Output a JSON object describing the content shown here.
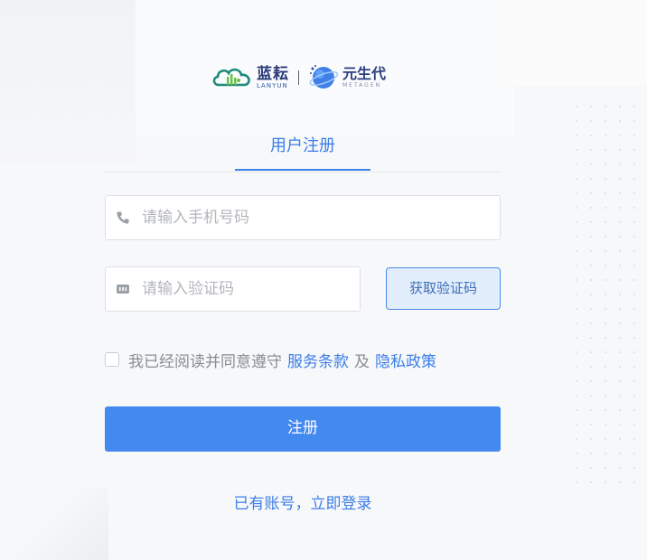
{
  "logo": {
    "lanyun_cn": "蓝耘",
    "lanyun_en": "LANYUN",
    "partner_cn": "元生代",
    "partner_en": "METAGEN"
  },
  "tabs": [
    {
      "label": "用户注册",
      "active": true
    }
  ],
  "form": {
    "phone_placeholder": "请输入手机号码",
    "phone_value": "",
    "code_placeholder": "请输入验证码",
    "code_value": "",
    "get_code_label": "获取验证码"
  },
  "agreement": {
    "text": "我已经阅读并同意遵守",
    "terms_link": "服务条款",
    "and": "及",
    "privacy_link": "隐私政策",
    "checked": false
  },
  "submit_label": "注册",
  "login_link": "已有账号，立即登录",
  "colors": {
    "accent": "#3b7de9",
    "button": "#4489ef",
    "code_button_bg": "#e3eefc"
  },
  "icons": {
    "phone": "phone-icon",
    "code": "keyboard-icon"
  }
}
